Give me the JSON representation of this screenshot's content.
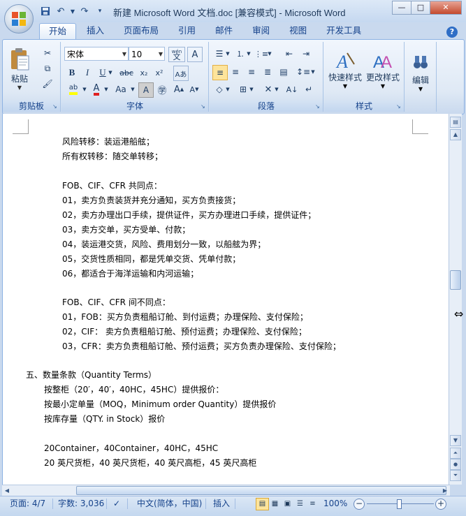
{
  "window": {
    "title": "新建 Microsoft Word 文档.doc [兼容模式] - Microsoft Word",
    "controls": {
      "minimize": "—",
      "maximize": "□",
      "close": "✕"
    }
  },
  "tabs": [
    "开始",
    "插入",
    "页面布局",
    "引用",
    "邮件",
    "审阅",
    "视图",
    "开发工具"
  ],
  "ribbon": {
    "clipboard": {
      "label": "剪贴板",
      "paste": "粘贴"
    },
    "font": {
      "label": "字体",
      "font_name": "宋体",
      "font_size": "10",
      "wen": "wén"
    },
    "paragraph": {
      "label": "段落"
    },
    "styles": {
      "label": "样式",
      "quick": "快速样式",
      "change": "更改样式"
    },
    "editing": {
      "label": "编辑"
    }
  },
  "document": {
    "lines": [
      "风险转移：装运港船舷；",
      "所有权转移：随交单转移；",
      "",
      "FOB、CIF、CFR 共同点：",
      "01，卖方负责装货并充分通知，买方负责接货；",
      "02，卖方办理出口手续，提供证件，买方办理进口手续，提供证件；",
      "03，卖方交单，买方受单、付款；",
      "04，装运港交货，风险、费用划分一致，以船舷为界；",
      "05，交货性质相同，都是凭单交货、凭单付款；",
      "06，都适合于海洋运输和内河运输；",
      "",
      "FOB、CIF、CFR 间不同点：",
      "01，FOB：买方负责租船订舱、到付运费；办理保险、支付保险；",
      "02，CIF：  卖方负责租船订舱、预付运费；办理保险、支付保险；",
      "03，CFR：卖方负责租船订舱、预付运费；买方负责办理保险、支付保险；",
      "",
      "五、数量条款（Quantity Terms）",
      "按整柜（20′，40′，40HC，45HC）提供报价：",
      "按最小定单量（MOQ，Minimum order Quantity）提供报价",
      "按库存量（QTY. in Stock）报价",
      "",
      "20Container，40Container，40HC，45HC",
      "20 英尺货柜，40 英尺货柜，40 英尺高柜，45 英尺高柜"
    ]
  },
  "statusbar": {
    "page": "页面: 4/7",
    "words": "字数: 3,036",
    "language": "中文(简体，中国)",
    "mode": "插入",
    "zoom": "100%"
  },
  "colors": {
    "accent": "#15428b",
    "ribbon_bg": "#dfe9f5",
    "highlight": "#fde49b"
  }
}
